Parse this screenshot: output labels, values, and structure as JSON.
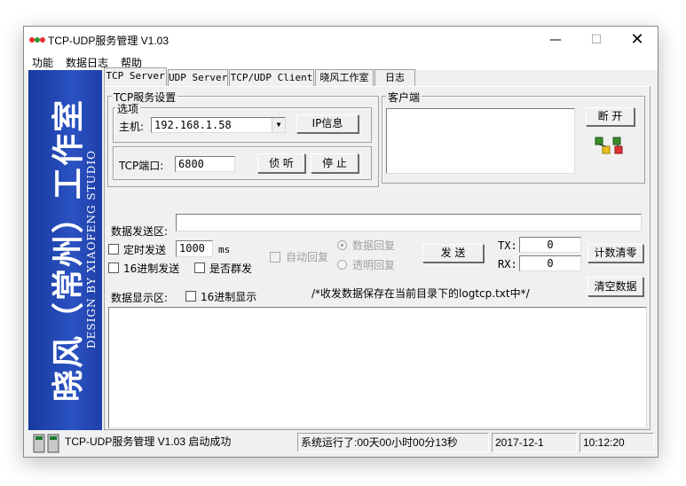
{
  "window": {
    "title": "TCP-UDP服务管理 V1.03",
    "controls": {
      "minimize": "—",
      "maximize": "☐",
      "close": "✕"
    }
  },
  "menu": [
    "功能",
    "数据日志",
    "帮助"
  ],
  "banner": {
    "main": "晓风（常州）工作室",
    "sub": "DESIGN BY XIAOFENG STUDIO"
  },
  "tabs": [
    {
      "label": "TCP Server",
      "active": true
    },
    {
      "label": "UDP Server",
      "active": false
    },
    {
      "label": "TCP/UDP Client",
      "active": false
    },
    {
      "label": "晓风工作室",
      "active": false
    },
    {
      "label": "日志",
      "active": false
    }
  ],
  "tcp_settings": {
    "group_label": "TCP服务设置",
    "options_label": "选项",
    "host_label": "主机:",
    "host_value": "192.168.1.58",
    "ip_info_button": "IP信息",
    "port_label": "TCP端口:",
    "port_value": "6800",
    "listen_button": "侦 听",
    "stop_button": "停 止"
  },
  "clients": {
    "group_label": "客户端",
    "disconnect_button": "断 开"
  },
  "send": {
    "area_label": "数据发送区:",
    "value": "",
    "timed_send_label": "定时发送",
    "interval_value": "1000",
    "interval_unit": "ms",
    "hex_send_label": "16进制发送",
    "broadcast_label": "是否群发",
    "auto_reply_label": "自动回复",
    "data_reply_label": "数据回复",
    "transparent_reply_label": "透明回复",
    "send_button": "发  送"
  },
  "counters": {
    "tx_label": "TX:",
    "tx_value": "0",
    "rx_label": "RX:",
    "rx_value": "0",
    "clear_counts_button": "计数清零"
  },
  "receive": {
    "area_label": "数据显示区:",
    "hex_display_label": "16进制显示",
    "log_note": "/*收发数据保存在当前目录下的logtcp.txt中*/",
    "clear_data_button": "清空数据"
  },
  "status": {
    "app": "TCP-UDP服务管理 V1.03 启动成功",
    "uptime": "系统运行了:00天00小时00分13秒",
    "date": "2017-12-1",
    "time": "10:12:20"
  }
}
